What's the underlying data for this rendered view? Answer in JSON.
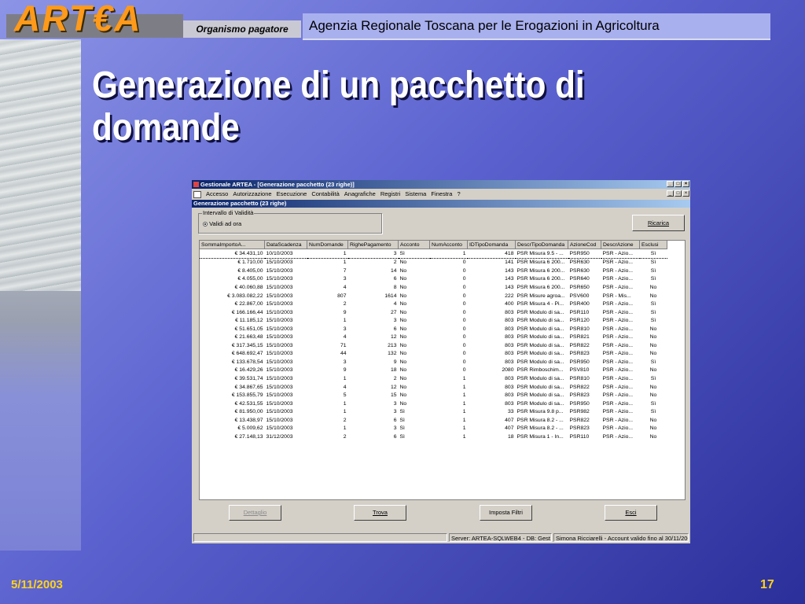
{
  "header": {
    "logo": "ART€A",
    "org": "Organismo pagatore",
    "agency": "Agenzia Regionale Toscana per le Erogazioni in Agricoltura"
  },
  "slide": {
    "title_line1": "Generazione di un pacchetto di",
    "title_line2": "domande",
    "date": "5/11/2003",
    "page": "17"
  },
  "window": {
    "title": "Gestionale ARTEA - [Generazione pacchetto (23 righe)]",
    "menu": [
      "Accesso",
      "Autorizzazione",
      "Esecuzione",
      "Contabilità",
      "Anagrafiche",
      "Registri",
      "Sistema",
      "Finestra",
      "?"
    ],
    "subtitle": "Generazione pacchetto (23 righe)",
    "group_label": "Intervallo di Validità",
    "radio_label": "Validi ad ora",
    "btn_ricarica": "Ricarica",
    "btn_dettaglio": "Dettaglio",
    "btn_trova": "Trova",
    "btn_filtri": "Imposta Filtri",
    "btn_esci": "Esci",
    "status_server": "Server: ARTEA-SQLWEB4 - DB: Gest_op",
    "status_user": "Simona Ricciarelli - Account valido fino al 30/11/2003"
  },
  "table": {
    "columns": [
      "SommaImportoA...",
      "DataScadenza",
      "NumDomande",
      "RighePagamento",
      "Acconto",
      "NumAcconto",
      "IDTipoDomanda",
      "DescrTipoDomanda",
      "AzioneCod",
      "DescrAzione",
      "Esclusi"
    ],
    "rows": [
      [
        "€ 34.431,10",
        "10/10/2003",
        "1",
        "3",
        "Sì",
        "1",
        "418",
        "PSR Misura 9.5 - ...",
        "PSR950",
        "PSR - Azio...",
        "Sì"
      ],
      [
        "€ 1.710,00",
        "15/10/2003",
        "1",
        "2",
        "No",
        "0",
        "141",
        "PSR Misura 6 200...",
        "PSR630",
        "PSR - Azio...",
        "Sì"
      ],
      [
        "€ 8.405,00",
        "15/10/2003",
        "7",
        "14",
        "No",
        "0",
        "143",
        "PSR Misura 6 200...",
        "PSR630",
        "PSR - Azio...",
        "Sì"
      ],
      [
        "€ 4.055,00",
        "15/10/2003",
        "3",
        "6",
        "No",
        "0",
        "143",
        "PSR Misura 6 200...",
        "PSR640",
        "PSR - Azio...",
        "Sì"
      ],
      [
        "€ 40.060,88",
        "15/10/2003",
        "4",
        "8",
        "No",
        "0",
        "143",
        "PSR Misura 6 200...",
        "PSR650",
        "PSR - Azio...",
        "No"
      ],
      [
        "€ 3.083.082,22",
        "15/10/2003",
        "807",
        "1614",
        "No",
        "0",
        "222",
        "PSR Misure agroa...",
        "PSV600",
        "PSR - Mis...",
        "No"
      ],
      [
        "€ 22.867,00",
        "15/10/2003",
        "2",
        "4",
        "No",
        "0",
        "400",
        "PSR Misura 4 - Pi...",
        "PSR400",
        "PSR - Azio...",
        "Sì"
      ],
      [
        "€ 166.166,44",
        "15/10/2003",
        "9",
        "27",
        "No",
        "0",
        "803",
        "PSR Modulo di sa...",
        "PSR110",
        "PSR - Azio...",
        "Sì"
      ],
      [
        "€ 11.185,12",
        "15/10/2003",
        "1",
        "3",
        "No",
        "0",
        "803",
        "PSR Modulo di sa...",
        "PSR120",
        "PSR - Azio...",
        "Sì"
      ],
      [
        "€ 51.651,05",
        "15/10/2003",
        "3",
        "6",
        "No",
        "0",
        "803",
        "PSR Modulo di sa...",
        "PSR810",
        "PSR - Azio...",
        "No"
      ],
      [
        "€ 21.663,48",
        "15/10/2003",
        "4",
        "12",
        "No",
        "0",
        "803",
        "PSR Modulo di sa...",
        "PSR821",
        "PSR - Azio...",
        "No"
      ],
      [
        "€ 317.345,15",
        "15/10/2003",
        "71",
        "213",
        "No",
        "0",
        "803",
        "PSR Modulo di sa...",
        "PSR822",
        "PSR - Azio...",
        "No"
      ],
      [
        "€ 648.692,47",
        "15/10/2003",
        "44",
        "132",
        "No",
        "0",
        "803",
        "PSR Modulo di sa...",
        "PSR823",
        "PSR - Azio...",
        "No"
      ],
      [
        "€ 133.678,54",
        "15/10/2003",
        "3",
        "9",
        "No",
        "0",
        "803",
        "PSR Modulo di sa...",
        "PSR950",
        "PSR - Azio...",
        "Sì"
      ],
      [
        "€ 16.429,26",
        "15/10/2003",
        "9",
        "18",
        "No",
        "0",
        "2080",
        "PSR Rimboschim...",
        "PSV810",
        "PSR - Azio...",
        "No"
      ],
      [
        "€ 39.531,74",
        "15/10/2003",
        "1",
        "2",
        "No",
        "1",
        "803",
        "PSR Modulo di sa...",
        "PSR810",
        "PSR - Azio...",
        "Sì"
      ],
      [
        "€ 34.867,65",
        "15/10/2003",
        "4",
        "12",
        "No",
        "1",
        "803",
        "PSR Modulo di sa...",
        "PSR822",
        "PSR - Azio...",
        "No"
      ],
      [
        "€ 153.855,79",
        "15/10/2003",
        "5",
        "15",
        "No",
        "1",
        "803",
        "PSR Modulo di sa...",
        "PSR823",
        "PSR - Azio...",
        "No"
      ],
      [
        "€ 42.531,55",
        "15/10/2003",
        "1",
        "3",
        "No",
        "1",
        "803",
        "PSR Modulo di sa...",
        "PSR950",
        "PSR - Azio...",
        "Sì"
      ],
      [
        "€ 81.950,00",
        "15/10/2003",
        "1",
        "3",
        "Sì",
        "1",
        "33",
        "PSR Misura 9.8 p...",
        "PSR982",
        "PSR - Azio...",
        "Sì"
      ],
      [
        "€ 13.438,97",
        "15/10/2003",
        "2",
        "6",
        "Sì",
        "1",
        "407",
        "PSR Misura 8.2 - ...",
        "PSR822",
        "PSR - Azio...",
        "No"
      ],
      [
        "€ 5.009,62",
        "15/10/2003",
        "1",
        "3",
        "Sì",
        "1",
        "407",
        "PSR Misura 8.2 - ...",
        "PSR823",
        "PSR - Azio...",
        "No"
      ],
      [
        "€ 27.148,13",
        "31/12/2003",
        "2",
        "6",
        "Sì",
        "1",
        "18",
        "PSR Misura 1 - In...",
        "PSR110",
        "PSR - Azio...",
        "No"
      ]
    ]
  }
}
